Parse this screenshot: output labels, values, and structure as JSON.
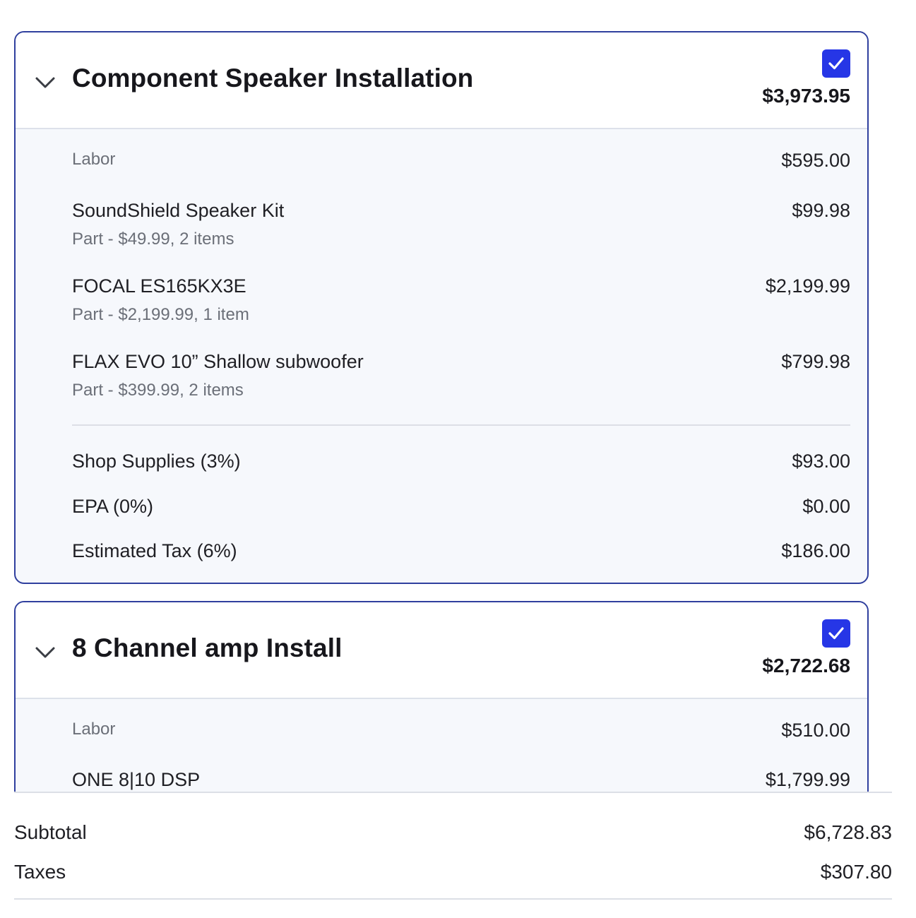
{
  "jobs": [
    {
      "title": "Component Speaker Installation",
      "total": "$3,973.95",
      "checked": true,
      "labor": {
        "label": "Labor",
        "price": "$595.00"
      },
      "parts": [
        {
          "name": "SoundShield Speaker Kit",
          "detail": "Part - $49.99, 2 items",
          "price": "$99.98"
        },
        {
          "name": "FOCAL ES165KX3E",
          "detail": "Part - $2,199.99, 1 item",
          "price": "$2,199.99"
        },
        {
          "name": "FLAX EVO 10” Shallow subwoofer",
          "detail": "Part - $399.99, 2 items",
          "price": "$799.98"
        }
      ],
      "fees": [
        {
          "label": "Shop Supplies (3%)",
          "price": "$93.00"
        },
        {
          "label": "EPA (0%)",
          "price": "$0.00"
        },
        {
          "label": "Estimated Tax (6%)",
          "price": "$186.00"
        }
      ]
    },
    {
      "title": "8 Channel amp Install",
      "total": "$2,722.68",
      "checked": true,
      "labor": {
        "label": "Labor",
        "price": "$510.00"
      },
      "parts": [
        {
          "name": "ONE 8|10 DSP",
          "price": "$1,799.99"
        }
      ]
    }
  ],
  "summary": {
    "subtotal_label": "Subtotal",
    "subtotal_value": "$6,728.83",
    "taxes_label": "Taxes",
    "taxes_value": "$307.80"
  },
  "colors": {
    "accent": "#2636e6",
    "card_border": "#2f3f9e",
    "card_body": "#f6f8fc",
    "muted_text": "#6b6f78"
  }
}
